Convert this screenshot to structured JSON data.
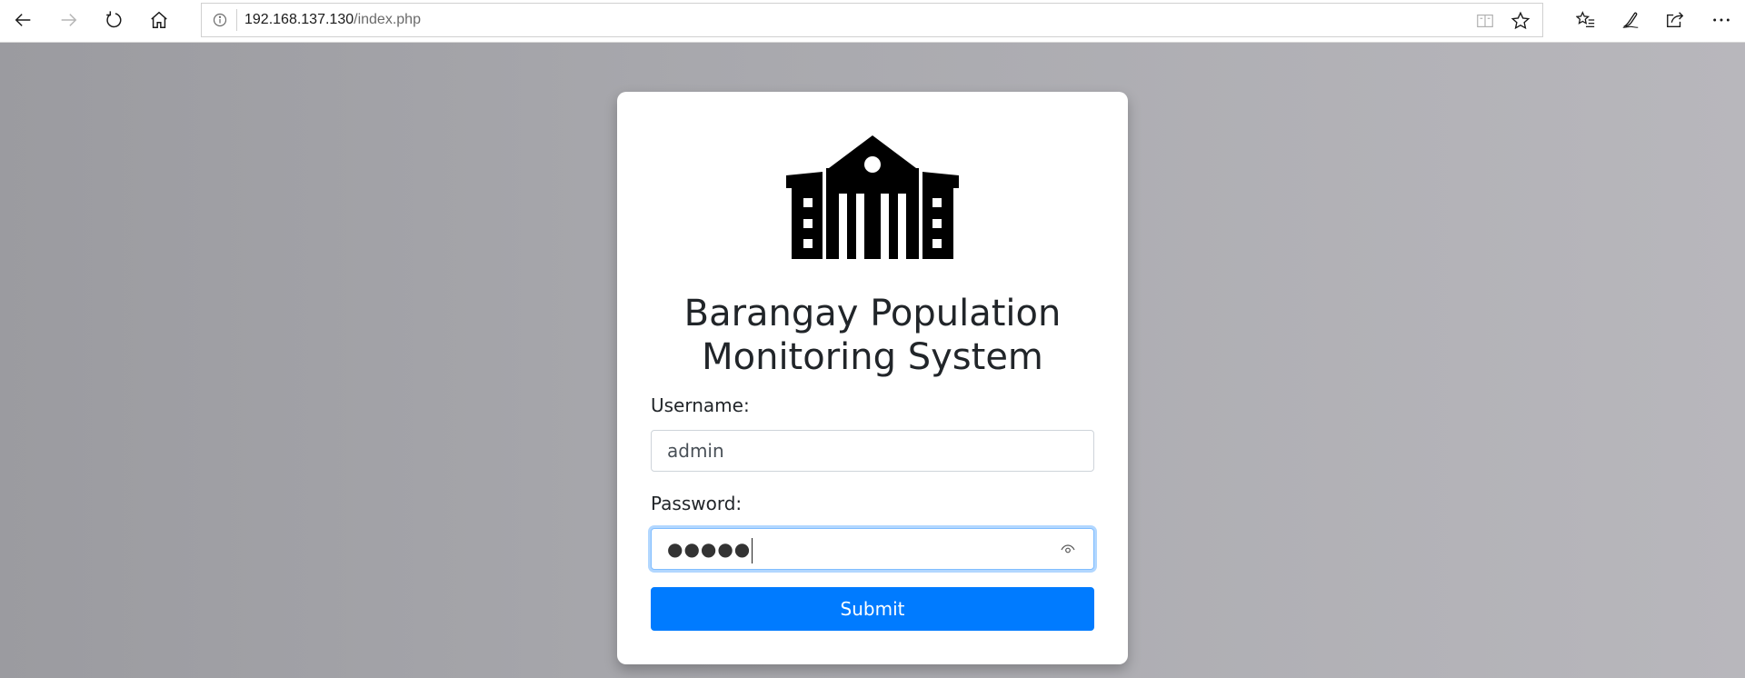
{
  "browser": {
    "url_host": "192.168.137.130",
    "url_path": "/index.php"
  },
  "icons": {
    "back": "arrow-left-icon",
    "forward": "arrow-right-icon",
    "refresh": "refresh-icon",
    "home": "home-icon",
    "site_info": "info-icon",
    "reading_view": "reading-view-icon",
    "favorite": "star-icon",
    "favorites_list": "favorites-list-icon",
    "notes": "pen-icon",
    "share": "share-icon",
    "more": "more-icon",
    "logo": "government-building-icon",
    "reveal": "eye-icon"
  },
  "login": {
    "title_line1": "Barangay Population",
    "title_line2": "Monitoring System",
    "username_label": "Username:",
    "username_value": "admin",
    "password_label": "Password:",
    "password_masked": "●●●●●",
    "submit_label": "Submit"
  },
  "colors": {
    "primary": "#007bff",
    "focus_border": "#80bdff",
    "text": "#212529",
    "background_start": "#9b9ba0",
    "background_end": "#b8b7bc"
  }
}
